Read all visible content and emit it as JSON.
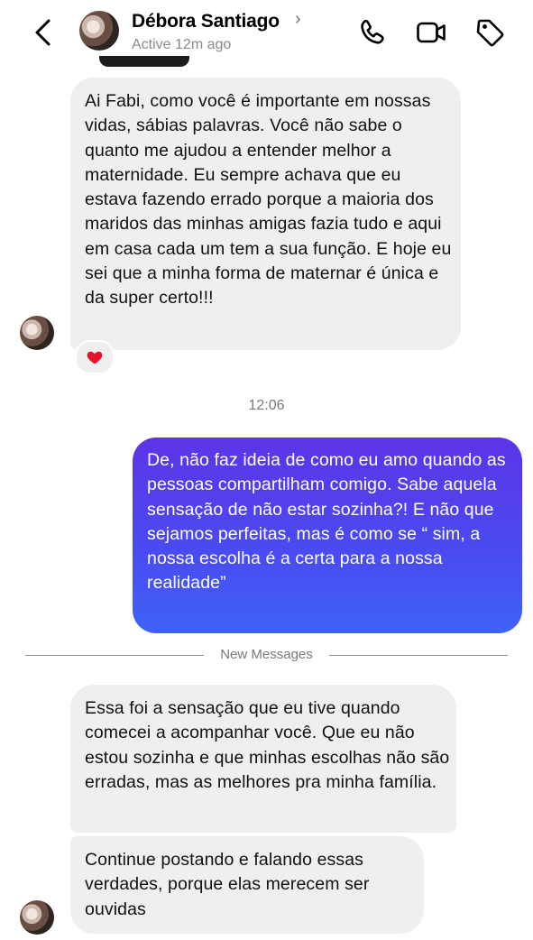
{
  "header": {
    "contact_name": "Débora Santiago",
    "chevron": "›",
    "status": "Active 12m ago",
    "icons": [
      "back-chevron-icon",
      "phone-icon",
      "video-camera-icon",
      "tag-icon"
    ]
  },
  "messages": [
    {
      "direction": "incoming",
      "text": "Ai Fabi, como você é importante em nossas vidas, sábias palavras. Você não sabe o quanto me ajudou a entender melhor a maternidade. Eu sempre achava que eu estava fazendo errado porque a maioria dos maridos das minhas amigas fazia tudo e aqui em casa cada um tem a sua função. E hoje eu sei que a minha forma de maternar é única e da super certo!!!",
      "reaction": "heart-icon"
    },
    {
      "direction": "outgoing",
      "text": "De, não faz ideia de como eu amo quando as pessoas compartilham comigo. Sabe aquela sensação de não estar sozinha?! E não que sejamos perfeitas, mas é como se “ sim, a nossa escolha é a certa para a nossa realidade”"
    },
    {
      "direction": "incoming",
      "text": "Essa foi a sensação que eu tive quando comecei a acompanhar você. Que eu não estou sozinha e que minhas escolhas não são erradas, mas as melhores pra minha família."
    },
    {
      "direction": "incoming",
      "text": "Continue postando e falando essas verdades, porque elas merecem ser ouvidas"
    }
  ],
  "timestamp": "12:06",
  "divider_label": "New Messages",
  "colors": {
    "outgoing_gradient_top": "#5c34e6",
    "outgoing_gradient_bottom": "#3f62f6",
    "incoming_bubble": "#efefef",
    "reaction_heart": "#e0142c"
  }
}
